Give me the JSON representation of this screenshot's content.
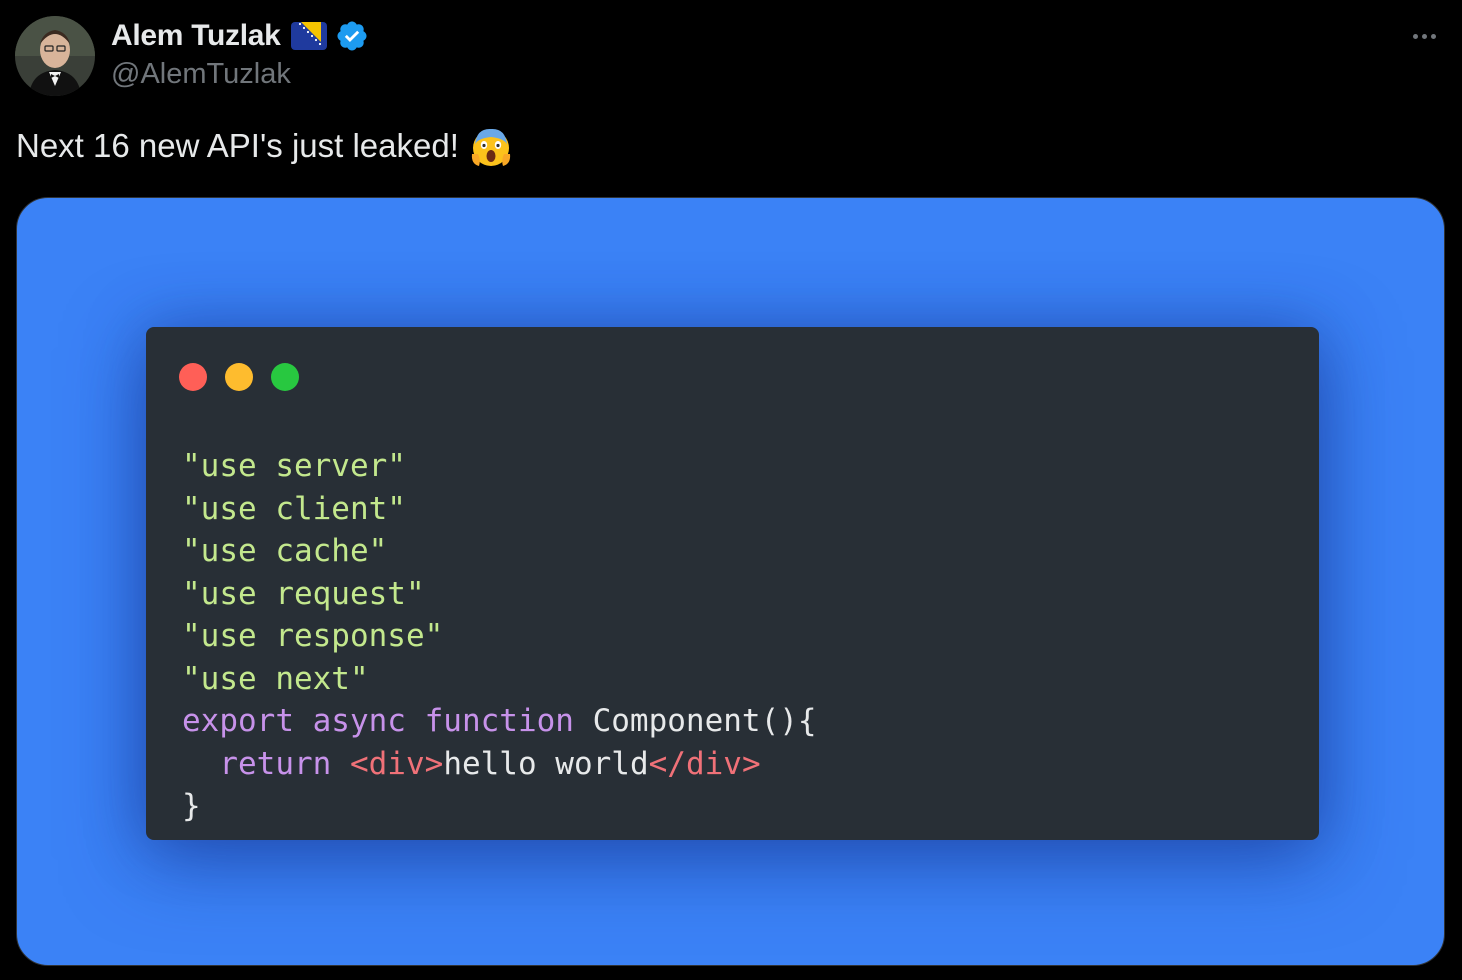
{
  "author": {
    "display_name": "Alem Tuzlak",
    "handle": "@AlemTuzlak",
    "flag_icon": "bosnia-herzegovina-flag-icon",
    "verified_icon": "verified-badge-icon"
  },
  "more_options_icon": "more-horizontal-icon",
  "tweet": {
    "text": "Next 16 new API's just leaked!",
    "emoji_icon": "face-screaming-in-fear-emoji"
  },
  "media": {
    "background_color": "#3b82f6",
    "window_color": "#282f36",
    "traffic_lights": [
      "#ff5f57",
      "#febc2e",
      "#28c840"
    ],
    "code_lines": [
      [
        {
          "text": "\"use server\"",
          "color": "#c3e88d"
        }
      ],
      [
        {
          "text": "\"use client\"",
          "color": "#c3e88d"
        }
      ],
      [
        {
          "text": "\"use cache\"",
          "color": "#c3e88d"
        }
      ],
      [
        {
          "text": "\"use request\"",
          "color": "#c3e88d"
        }
      ],
      [
        {
          "text": "\"use response\"",
          "color": "#c3e88d"
        }
      ],
      [
        {
          "text": "\"use next\"",
          "color": "#c3e88d"
        }
      ],
      [
        {
          "text": "export async function",
          "color": "#c792ea"
        },
        {
          "text": " Component(){",
          "color": "#e7e9ea"
        }
      ],
      [
        {
          "text": "  return ",
          "color": "#c792ea"
        },
        {
          "text": "<div>",
          "color": "#f07178"
        },
        {
          "text": "hello world",
          "color": "#e7e9ea"
        },
        {
          "text": "</div>",
          "color": "#f07178"
        }
      ],
      [
        {
          "text": "}",
          "color": "#e7e9ea"
        }
      ]
    ]
  }
}
